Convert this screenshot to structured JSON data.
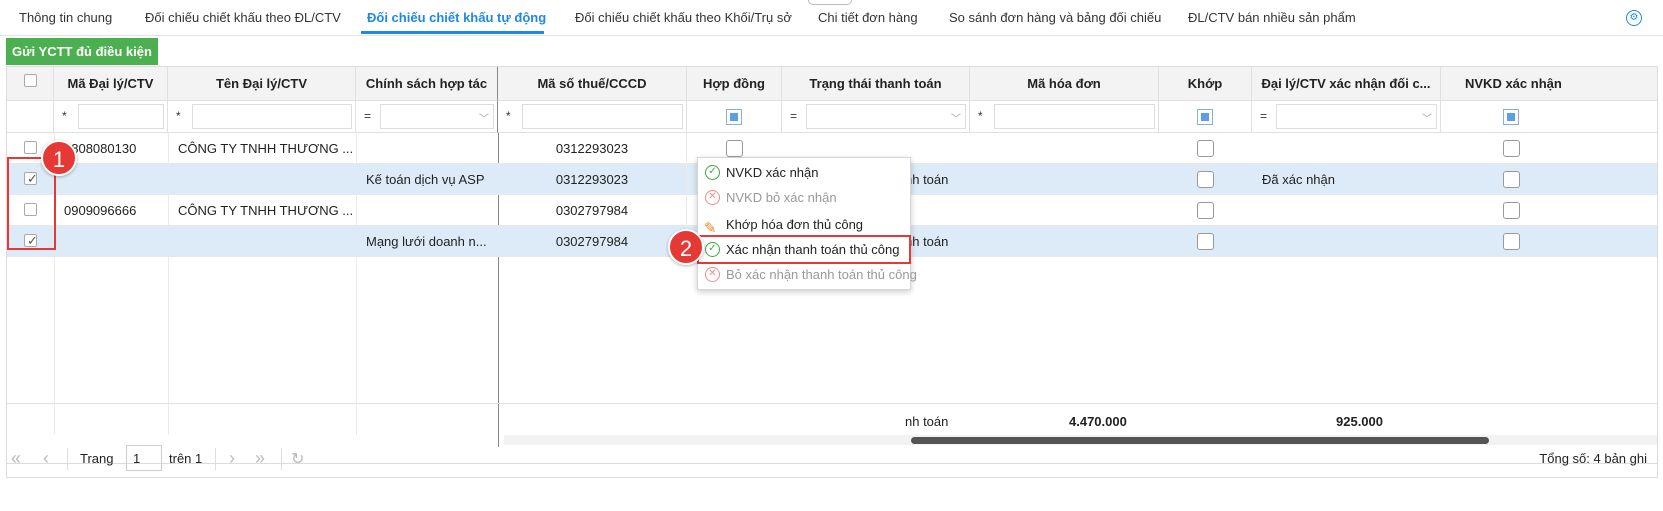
{
  "tabs": [
    {
      "label": "Thông tin chung"
    },
    {
      "label": "Đối chiếu chiết khấu theo ĐL/CTV"
    },
    {
      "label": "Đối chiếu chiết khấu tự động",
      "active": true
    },
    {
      "label": "Đối chiếu chiết khấu theo Khối/Trụ sở"
    },
    {
      "label": "Chi tiết đơn hàng"
    },
    {
      "label": "So sánh đơn hàng và bảng đối chiếu"
    },
    {
      "label": "ĐL/CTV bán nhiều sản phẩm"
    }
  ],
  "toolbar": {
    "send_label": "Gửi YCTT đủ điều kiện"
  },
  "columns": [
    "Mã Đại lý/CTV",
    "Tên Đại lý/CTV",
    "Chính sách hợp tác",
    "Mã số thuế/CCCD",
    "Hợp đồng",
    "Trạng thái thanh toán",
    "Mã hóa đơn",
    "Khớp",
    "Đại lý/CTV xác nhận đối c...",
    "NVKD xác nhận"
  ],
  "filters": {
    "star": "*",
    "equals": "="
  },
  "rows": [
    {
      "code": "0808080130",
      "name": "CÔNG TY TNHH THƯƠNG ...",
      "policy": "",
      "tax": "0312293023",
      "status": "",
      "agent_confirm": "",
      "checked": false,
      "selected": false
    },
    {
      "code": "",
      "name": "",
      "policy": "Kế toán dịch vụ ASP",
      "tax": "0312293023",
      "status": "nh toán",
      "agent_confirm": "Đã xác nhận",
      "checked": true,
      "selected": true
    },
    {
      "code": "0909096666",
      "name": "CÔNG TY TNHH THƯƠNG ...",
      "policy": "",
      "tax": "0302797984",
      "status": "",
      "agent_confirm": "",
      "checked": false,
      "selected": false
    },
    {
      "code": "",
      "name": "",
      "policy": "Mạng lưới doanh n...",
      "tax": "0302797984",
      "status": "nh toán",
      "agent_confirm": "",
      "checked": true,
      "selected": true
    }
  ],
  "footer": {
    "partial_status": "nh toán",
    "total_invoice": "4.470.000",
    "total_agent": "925.000"
  },
  "context_menu": [
    {
      "label": "NVKD xác nhận",
      "icon": "check-circle-icon",
      "enabled": true
    },
    {
      "label": "NVKD bỏ xác nhận",
      "icon": "x-circle-icon",
      "enabled": false
    },
    {
      "label": "Khớp hóa đơn thủ công",
      "icon": "edit-icon",
      "enabled": true
    },
    {
      "label": "Xác nhận thanh toán thủ công",
      "icon": "check-circle-icon",
      "enabled": true
    },
    {
      "label": "Bỏ xác nhận thanh toán thủ công",
      "icon": "x-circle-icon",
      "enabled": false
    }
  ],
  "annotations": {
    "step1": "1",
    "step2": "2"
  },
  "pager": {
    "page_label": "Trang",
    "page_value": "1",
    "of_label": "trên 1",
    "total_label": "Tổng số: 4 bản ghi"
  },
  "colors": {
    "accent": "#1e88e5",
    "button_green": "#4caf50",
    "selected_row": "#dcebf7",
    "annotation_red": "#e53935"
  }
}
